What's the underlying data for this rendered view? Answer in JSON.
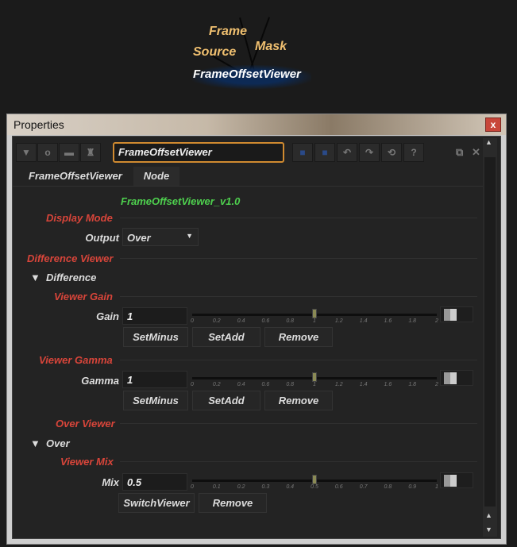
{
  "graph": {
    "nodes": {
      "frame": "Frame",
      "source": "Source",
      "mask": "Mask",
      "viewer": "FrameOffsetViewer"
    }
  },
  "window": {
    "title": "Properties",
    "close": "x"
  },
  "toolbar": {
    "name_value": "FrameOffsetViewer"
  },
  "tabs": [
    {
      "label": "FrameOffsetViewer",
      "active": true
    },
    {
      "label": "Node",
      "active": false
    }
  ],
  "version": "FrameOffsetViewer_v1.0",
  "display_mode": {
    "heading": "Display Mode",
    "output_label": "Output",
    "output_value": "Over"
  },
  "difference_viewer": {
    "heading": "Difference Viewer",
    "group": "Difference",
    "gain": {
      "heading": "Viewer Gain",
      "label": "Gain",
      "value": "1",
      "slider_value": 1,
      "ticks": [
        "0",
        "0.2",
        "0.4",
        "0.6",
        "0.8",
        "1",
        "1.2",
        "1.4",
        "1.6",
        "1.8",
        "2"
      ]
    },
    "gain_buttons": [
      "SetMinus",
      "SetAdd",
      "Remove"
    ],
    "gamma": {
      "heading": "Viewer Gamma",
      "label": "Gamma",
      "value": "1",
      "slider_value": 1,
      "ticks": [
        "0",
        "0.2",
        "0.4",
        "0.6",
        "0.8",
        "1",
        "1.2",
        "1.4",
        "1.6",
        "1.8",
        "2"
      ]
    },
    "gamma_buttons": [
      "SetMinus",
      "SetAdd",
      "Remove"
    ]
  },
  "over_viewer": {
    "heading": "Over Viewer",
    "group": "Over",
    "mix": {
      "heading": "Viewer Mix",
      "label": "Mix",
      "value": "0.5",
      "slider_value": 0.5,
      "ticks": [
        "0",
        "0.1",
        "0.2",
        "0.3",
        "0.4",
        "0.5",
        "0.6",
        "0.7",
        "0.8",
        "0.9",
        "1"
      ]
    },
    "buttons": [
      "SwitchViewer",
      "Remove"
    ]
  },
  "colors": {
    "accent_input": "#d08a30",
    "label_red": "#d8453a",
    "version_green": "#4ed04e"
  }
}
